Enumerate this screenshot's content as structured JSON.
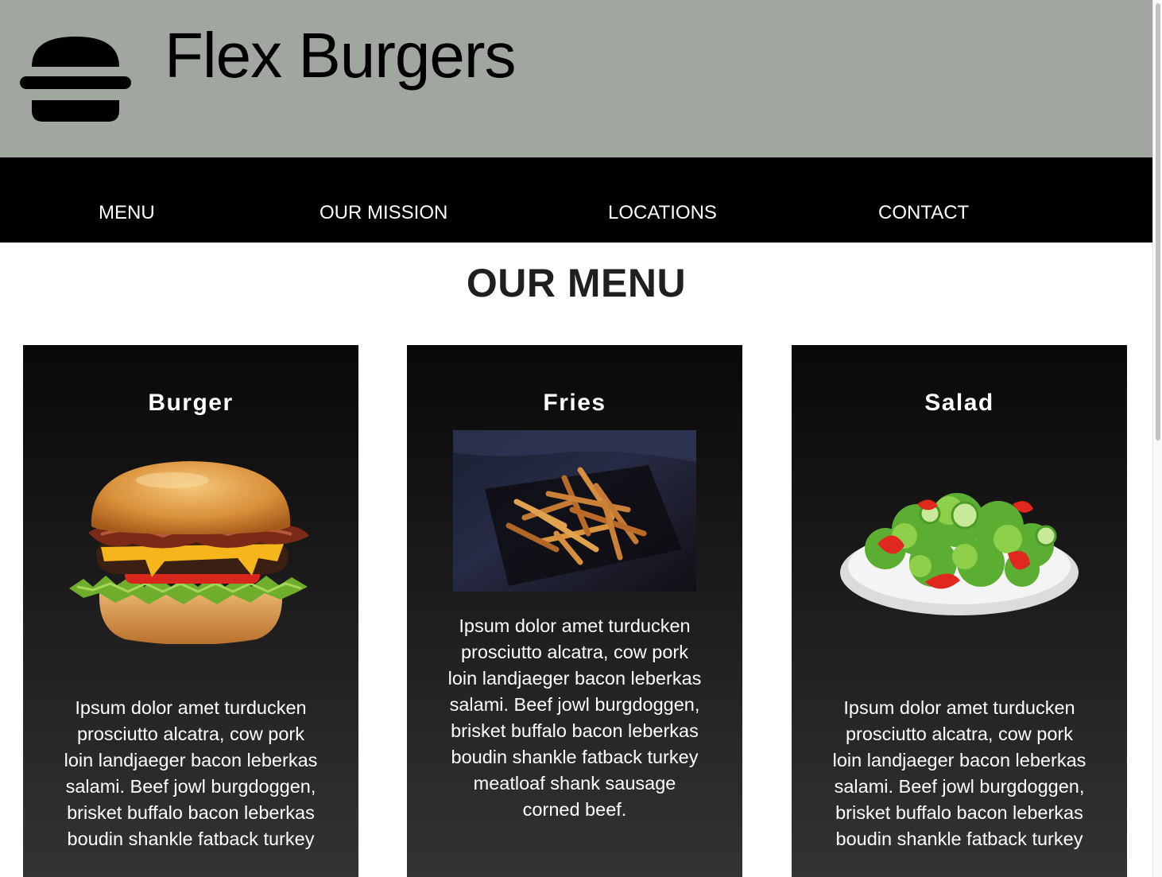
{
  "header": {
    "title": "Flex Burgers",
    "logo_icon": "burger-icon",
    "background": "#a1a6a0"
  },
  "nav": {
    "items": [
      {
        "label": "MENU"
      },
      {
        "label": "OUR MISSION"
      },
      {
        "label": "LOCATIONS"
      },
      {
        "label": "CONTACT"
      }
    ],
    "background": "#000000"
  },
  "main": {
    "heading": "OUR MENU",
    "cards": [
      {
        "title": "Burger",
        "image": "burger-photo",
        "text": "Ipsum dolor amet turducken prosciutto alcatra, cow pork loin landjaeger bacon leberkas salami. Beef jowl burgdoggen, brisket buffalo bacon leberkas boudin shankle fatback turkey"
      },
      {
        "title": "Fries",
        "image": "fries-photo",
        "text": "Ipsum dolor amet turducken prosciutto alcatra, cow pork loin landjaeger bacon leberkas salami. Beef jowl burgdoggen, brisket buffalo bacon leberkas boudin shankle fatback turkey meatloaf shank sausage corned beef."
      },
      {
        "title": "Salad",
        "image": "salad-photo",
        "text": "Ipsum dolor amet turducken prosciutto alcatra, cow pork loin landjaeger bacon leberkas salami. Beef jowl burgdoggen, brisket buffalo bacon leberkas boudin shankle fatback turkey"
      }
    ]
  }
}
